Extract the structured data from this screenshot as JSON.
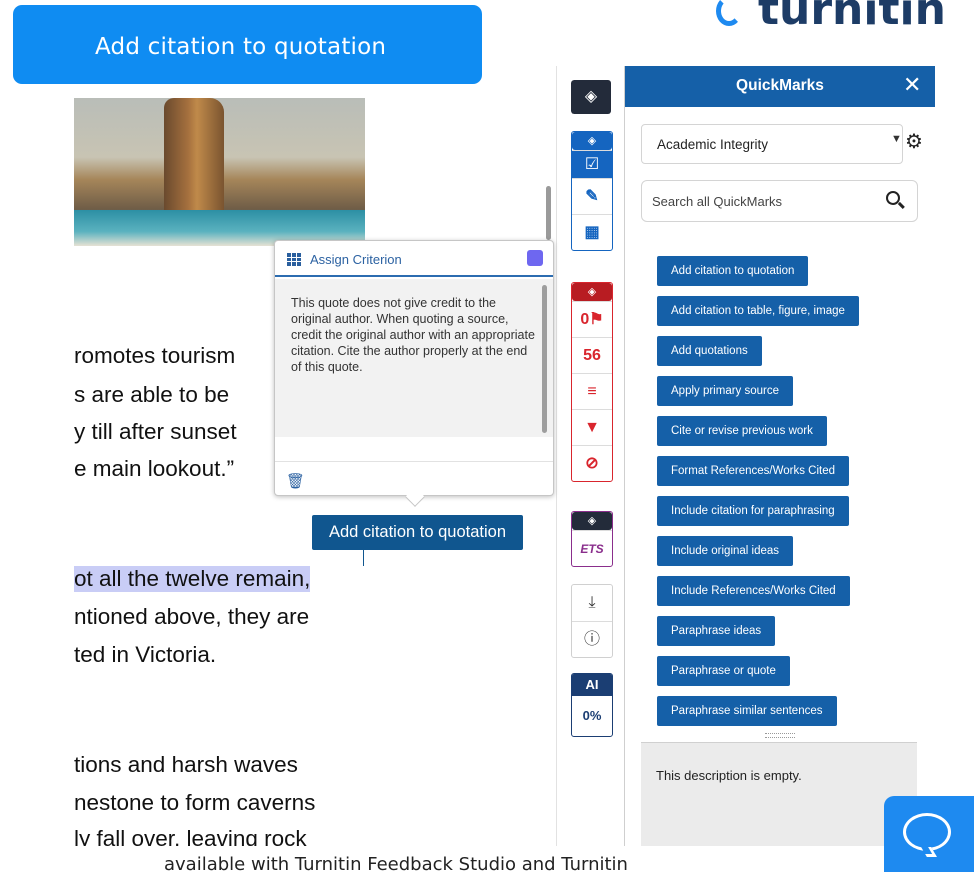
{
  "banner": {
    "text": "Add citation to quotation"
  },
  "logo": {
    "text": "turnitin"
  },
  "document": {
    "lines": [
      {
        "text": "romotes tourism"
      },
      {
        "text": "s are able to be"
      },
      {
        "text": "y till after sunset"
      },
      {
        "text": "e main lookout.”"
      },
      {
        "text": "ot all the twelve remain,"
      },
      {
        "text": "ntioned above, they are"
      },
      {
        "text": "ted in Victoria."
      },
      {
        "text": "tions and harsh waves"
      },
      {
        "text": "nestone to form caverns"
      },
      {
        "text": "ly fall over, leaving rock"
      }
    ]
  },
  "criterion_popup": {
    "title": "Assign Criterion",
    "swatch_color": "#6e67f0",
    "body": "This quote does not give credit to the original author. When quoting a source, credit the original author with an appropriate citation. Cite the author properly at the end of this quote."
  },
  "quickmark_tag": {
    "label": "Add citation to quotation"
  },
  "toolbar": {
    "flag_count": "0",
    "similarity_score": "56",
    "ai_label": "AI",
    "ai_score": "0%",
    "ets_label": "ETS"
  },
  "quickmarks": {
    "title": "QuickMarks",
    "set_selected": "Academic Integrity",
    "search_placeholder": "Search all QuickMarks",
    "items": [
      {
        "label": "Add citation to quotation"
      },
      {
        "label": "Add citation to table, figure, image"
      },
      {
        "label": "Add quotations"
      },
      {
        "label": "Apply primary source"
      },
      {
        "label": "Cite or revise previous work"
      },
      {
        "label": "Format References/Works Cited"
      },
      {
        "label": "Include citation for paraphrasing"
      },
      {
        "label": "Include original ideas"
      },
      {
        "label": "Include References/Works Cited"
      },
      {
        "label": "Paraphrase ideas"
      },
      {
        "label": "Paraphrase or quote"
      },
      {
        "label": "Paraphrase similar sentences"
      }
    ],
    "description": "This description is empty."
  },
  "caption": {
    "text": "available with Turnitin Feedback Studio and Turnitin"
  },
  "colors": {
    "brand_blue": "#1560a8",
    "banner_blue": "#0f8cf2",
    "alert_red": "#d9252d",
    "ets_purple": "#8a2e8c",
    "highlight": "#c9cdf6"
  }
}
